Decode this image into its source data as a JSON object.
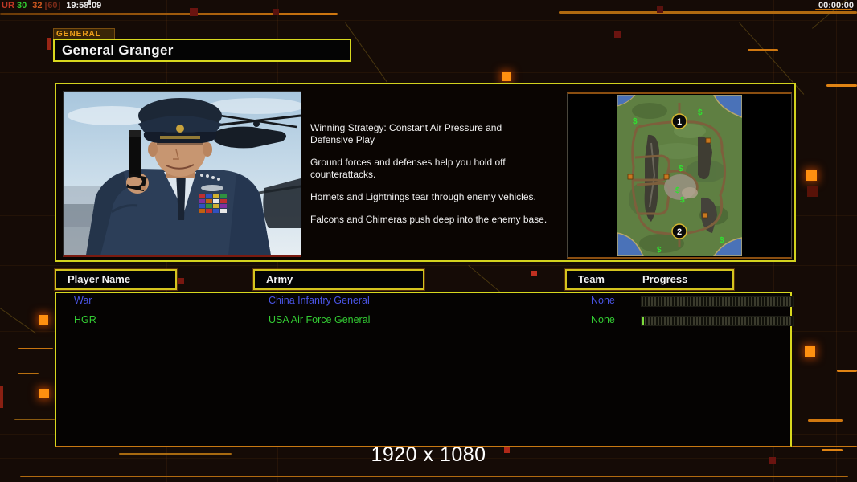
{
  "debug": {
    "t1": "UR",
    "t2": "30",
    "t3": "32",
    "t4": "[60]",
    "clock": "19:58:09",
    "colors": {
      "t1": "#c03826",
      "t1b": "#30b030",
      "t2": "#30c830",
      "t3": "#d05820",
      "t4": "#7a2a18",
      "clock": "#e8e8e8"
    }
  },
  "timer": "00:00:00",
  "header": {
    "tag": "GENERAL",
    "title": "General Granger"
  },
  "strategy": {
    "para1": "Winning Strategy: Constant Air Pressure and\n Defensive Play",
    "para2": "Ground forces and defenses help you hold off\n counterattacks.",
    "para3": "Hornets and Lightnings tear through enemy vehicles.",
    "para4": "Falcons and Chimeras push deep into the enemy base."
  },
  "map": {
    "start_marker_1": "1",
    "start_marker_2": "2",
    "supply_symbol": "$"
  },
  "table": {
    "headers": {
      "player_name": "Player Name",
      "army": "Army",
      "team": "Team",
      "progress": "Progress"
    },
    "rows": [
      {
        "name": "War",
        "army": "China Infantry General",
        "team": "None",
        "progress_pct": 0,
        "color": "#4a55e6"
      },
      {
        "name": "HGR",
        "army": "USA Air Force General",
        "team": "None",
        "progress_pct": 1.5,
        "color": "#33cc33"
      }
    ]
  },
  "footer": {
    "resolution": "1920 x 1080"
  },
  "colors": {
    "panel_border": "#d2d21e",
    "accent_orange": "#c87410",
    "bright_square": "#ff9010",
    "background": "#150b06"
  }
}
